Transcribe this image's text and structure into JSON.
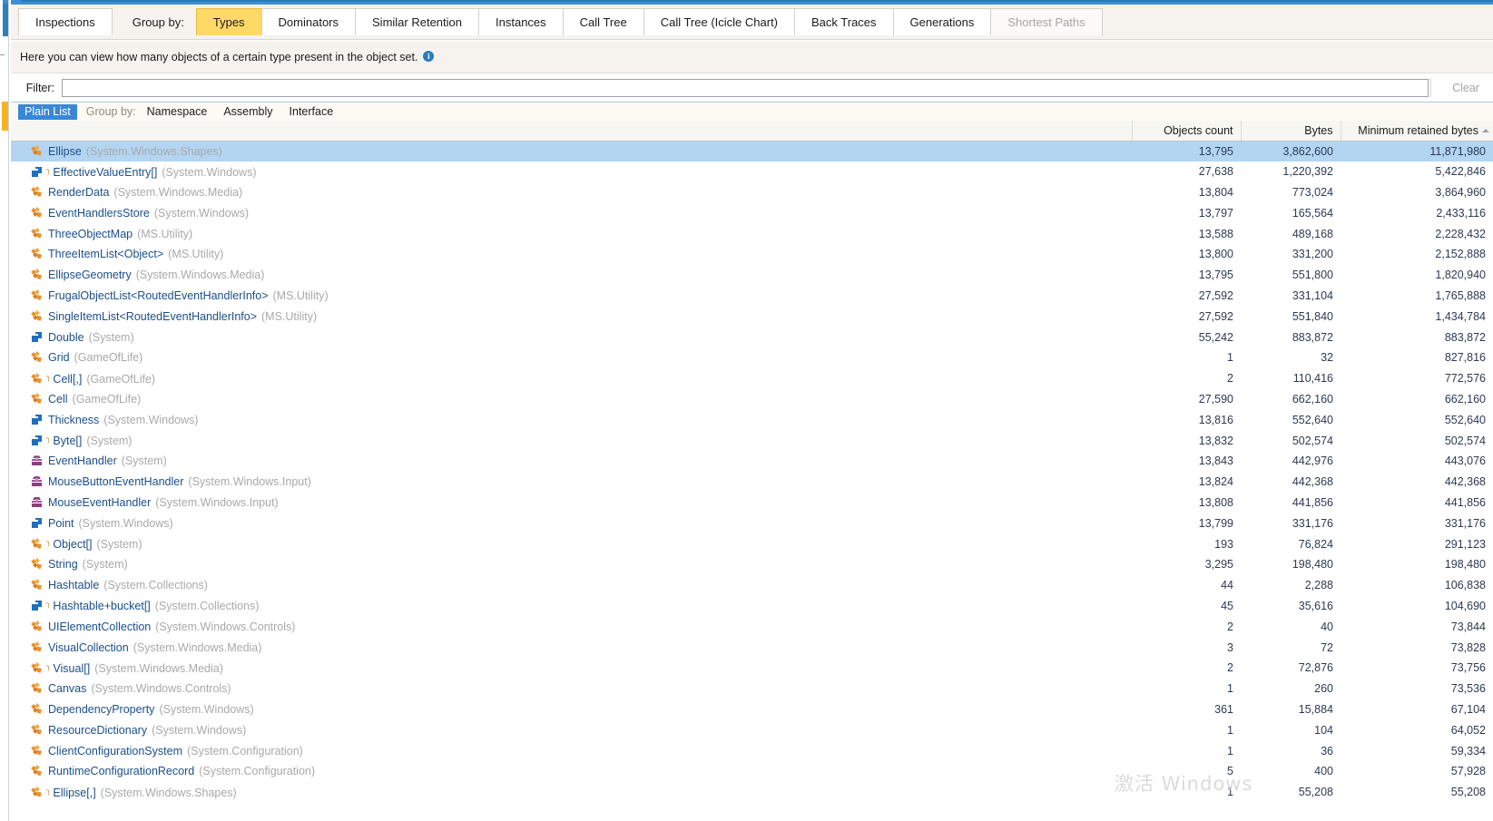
{
  "tabs": [
    {
      "label": "Inspections",
      "state": "normal"
    },
    {
      "label": "Group by:",
      "state": "label"
    },
    {
      "label": "Types",
      "state": "active"
    },
    {
      "label": "Dominators",
      "state": "normal"
    },
    {
      "label": "Similar Retention",
      "state": "normal"
    },
    {
      "label": "Instances",
      "state": "normal"
    },
    {
      "label": "Call Tree",
      "state": "normal"
    },
    {
      "label": "Call Tree (Icicle Chart)",
      "state": "normal"
    },
    {
      "label": "Back Traces",
      "state": "normal"
    },
    {
      "label": "Generations",
      "state": "normal"
    },
    {
      "label": "Shortest Paths",
      "state": "disabled"
    }
  ],
  "description": {
    "text": "Here you can view how many objects of a certain type present in the object set.",
    "info_icon": "info-icon"
  },
  "filter": {
    "label": "Filter:",
    "value": "",
    "placeholder": "",
    "clear_label": "Clear"
  },
  "listbar": {
    "pill": "Plain List",
    "group_by_label": "Group by:",
    "group_by_options": [
      "Namespace",
      "Assembly",
      "Interface"
    ]
  },
  "columns": {
    "name": "",
    "objects_count": "Objects count",
    "bytes": "Bytes",
    "min_retained": "Minimum retained bytes",
    "sort_column": "Minimum retained bytes",
    "sort_direction": "descending"
  },
  "colors": {
    "selection": "#b3d5f2",
    "active_tab": "#ffd966",
    "pill": "#3a87d6",
    "type_name": "#1b4f8a",
    "namespace": "#a9a9a9",
    "class_icon": "#e8912c",
    "struct_icon": "#1f6fbf",
    "delegate_icon": "#8b3f7e"
  },
  "watermark": {
    "line1": "激活 Windows",
    "line2": "Windows"
  },
  "rows": [
    {
      "icon": "class",
      "array": false,
      "name": "Ellipse",
      "ns": "(System.Windows.Shapes)",
      "count": "13,795",
      "bytes": "3,862,600",
      "min": "11,871,980",
      "selected": true
    },
    {
      "icon": "struct",
      "array": true,
      "name": "EffectiveValueEntry[]",
      "ns": "(System.Windows)",
      "count": "27,638",
      "bytes": "1,220,392",
      "min": "5,422,846",
      "selected": false
    },
    {
      "icon": "class",
      "array": false,
      "name": "RenderData",
      "ns": "(System.Windows.Media)",
      "count": "13,804",
      "bytes": "773,024",
      "min": "3,864,960",
      "selected": false
    },
    {
      "icon": "class",
      "array": false,
      "name": "EventHandlersStore",
      "ns": "(System.Windows)",
      "count": "13,797",
      "bytes": "165,564",
      "min": "2,433,116",
      "selected": false
    },
    {
      "icon": "class",
      "array": false,
      "name": "ThreeObjectMap",
      "ns": "(MS.Utility)",
      "count": "13,588",
      "bytes": "489,168",
      "min": "2,228,432",
      "selected": false
    },
    {
      "icon": "class",
      "array": false,
      "name": "ThreeItemList<Object>",
      "ns": "(MS.Utility)",
      "count": "13,800",
      "bytes": "331,200",
      "min": "2,152,888",
      "selected": false
    },
    {
      "icon": "class",
      "array": false,
      "name": "EllipseGeometry",
      "ns": "(System.Windows.Media)",
      "count": "13,795",
      "bytes": "551,800",
      "min": "1,820,940",
      "selected": false
    },
    {
      "icon": "class",
      "array": false,
      "name": "FrugalObjectList<RoutedEventHandlerInfo>",
      "ns": "(MS.Utility)",
      "count": "27,592",
      "bytes": "331,104",
      "min": "1,765,888",
      "selected": false
    },
    {
      "icon": "class",
      "array": false,
      "name": "SingleItemList<RoutedEventHandlerInfo>",
      "ns": "(MS.Utility)",
      "count": "27,592",
      "bytes": "551,840",
      "min": "1,434,784",
      "selected": false
    },
    {
      "icon": "struct",
      "array": false,
      "name": "Double",
      "ns": "(System)",
      "count": "55,242",
      "bytes": "883,872",
      "min": "883,872",
      "selected": false
    },
    {
      "icon": "class",
      "array": false,
      "name": "Grid",
      "ns": "(GameOfLife)",
      "count": "1",
      "bytes": "32",
      "min": "827,816",
      "selected": false
    },
    {
      "icon": "class",
      "array": true,
      "name": "Cell[,]",
      "ns": "(GameOfLife)",
      "count": "2",
      "bytes": "110,416",
      "min": "772,576",
      "selected": false
    },
    {
      "icon": "class",
      "array": false,
      "name": "Cell",
      "ns": "(GameOfLife)",
      "count": "27,590",
      "bytes": "662,160",
      "min": "662,160",
      "selected": false
    },
    {
      "icon": "struct",
      "array": false,
      "name": "Thickness",
      "ns": "(System.Windows)",
      "count": "13,816",
      "bytes": "552,640",
      "min": "552,640",
      "selected": false
    },
    {
      "icon": "struct",
      "array": true,
      "name": "Byte[]",
      "ns": "(System)",
      "count": "13,832",
      "bytes": "502,574",
      "min": "502,574",
      "selected": false
    },
    {
      "icon": "delegate",
      "array": false,
      "name": "EventHandler",
      "ns": "(System)",
      "count": "13,843",
      "bytes": "442,976",
      "min": "443,076",
      "selected": false
    },
    {
      "icon": "delegate",
      "array": false,
      "name": "MouseButtonEventHandler",
      "ns": "(System.Windows.Input)",
      "count": "13,824",
      "bytes": "442,368",
      "min": "442,368",
      "selected": false
    },
    {
      "icon": "delegate",
      "array": false,
      "name": "MouseEventHandler",
      "ns": "(System.Windows.Input)",
      "count": "13,808",
      "bytes": "441,856",
      "min": "441,856",
      "selected": false
    },
    {
      "icon": "struct",
      "array": false,
      "name": "Point",
      "ns": "(System.Windows)",
      "count": "13,799",
      "bytes": "331,176",
      "min": "331,176",
      "selected": false
    },
    {
      "icon": "class",
      "array": true,
      "name": "Object[]",
      "ns": "(System)",
      "count": "193",
      "bytes": "76,824",
      "min": "291,123",
      "selected": false
    },
    {
      "icon": "class",
      "array": false,
      "name": "String",
      "ns": "(System)",
      "count": "3,295",
      "bytes": "198,480",
      "min": "198,480",
      "selected": false
    },
    {
      "icon": "class",
      "array": false,
      "name": "Hashtable",
      "ns": "(System.Collections)",
      "count": "44",
      "bytes": "2,288",
      "min": "106,838",
      "selected": false
    },
    {
      "icon": "struct",
      "array": true,
      "name": "Hashtable+bucket[]",
      "ns": "(System.Collections)",
      "count": "45",
      "bytes": "35,616",
      "min": "104,690",
      "selected": false
    },
    {
      "icon": "class",
      "array": false,
      "name": "UIElementCollection",
      "ns": "(System.Windows.Controls)",
      "count": "2",
      "bytes": "40",
      "min": "73,844",
      "selected": false
    },
    {
      "icon": "class",
      "array": false,
      "name": "VisualCollection",
      "ns": "(System.Windows.Media)",
      "count": "3",
      "bytes": "72",
      "min": "73,828",
      "selected": false
    },
    {
      "icon": "class",
      "array": true,
      "name": "Visual[]",
      "ns": "(System.Windows.Media)",
      "count": "2",
      "bytes": "72,876",
      "min": "73,756",
      "selected": false
    },
    {
      "icon": "class",
      "array": false,
      "name": "Canvas",
      "ns": "(System.Windows.Controls)",
      "count": "1",
      "bytes": "260",
      "min": "73,536",
      "selected": false
    },
    {
      "icon": "class",
      "array": false,
      "name": "DependencyProperty",
      "ns": "(System.Windows)",
      "count": "361",
      "bytes": "15,884",
      "min": "67,104",
      "selected": false
    },
    {
      "icon": "class",
      "array": false,
      "name": "ResourceDictionary",
      "ns": "(System.Windows)",
      "count": "1",
      "bytes": "104",
      "min": "64,052",
      "selected": false
    },
    {
      "icon": "class",
      "array": false,
      "name": "ClientConfigurationSystem",
      "ns": "(System.Configuration)",
      "count": "1",
      "bytes": "36",
      "min": "59,334",
      "selected": false
    },
    {
      "icon": "class",
      "array": false,
      "name": "RuntimeConfigurationRecord",
      "ns": "(System.Configuration)",
      "count": "5",
      "bytes": "400",
      "min": "57,928",
      "selected": false
    },
    {
      "icon": "class",
      "array": true,
      "name": "Ellipse[,]",
      "ns": "(System.Windows.Shapes)",
      "count": "1",
      "bytes": "55,208",
      "min": "55,208",
      "selected": false
    }
  ]
}
